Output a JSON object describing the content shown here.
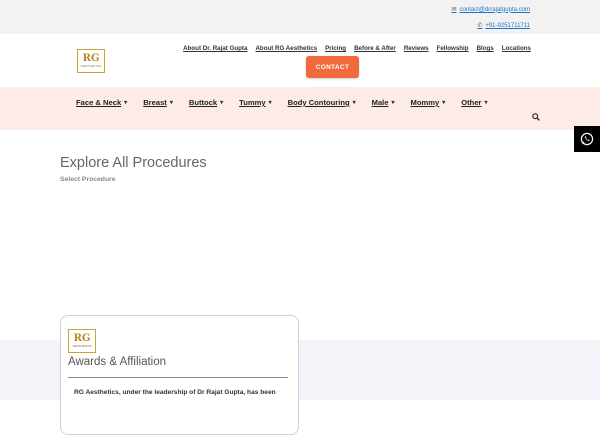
{
  "contact": {
    "email": "contact@drrajatgupta.com",
    "phone": "+91-9251711711",
    "email_icon": "envelope-icon",
    "phone_icon": "phone-icon"
  },
  "logo": {
    "mark": "RG",
    "sub": "AESTHETICS"
  },
  "topnav": [
    "About Dr. Rajat Gupta",
    "About RG Aesthetics",
    "Pricing",
    "Before & After",
    "Reviews",
    "Fellowship",
    "Blogs",
    "Locations"
  ],
  "contact_button": "CONTACT",
  "mainnav": [
    "Face & Neck",
    "Breast",
    "Buttock",
    "Tummy",
    "Body Contouring",
    "Male",
    "Mommy",
    "Other"
  ],
  "page": {
    "title": "Explore All Procedures",
    "subtitle": "Select Procedure"
  },
  "card": {
    "title": "Awards & Affiliation",
    "text": "RG Aesthetics, under the leadership of Dr Rajat Gupta, has been"
  },
  "colors": {
    "accent": "#f26a3c",
    "menu_band": "#fcebe6",
    "link": "#1a73c8",
    "logo_gold": "#b88a1e"
  }
}
